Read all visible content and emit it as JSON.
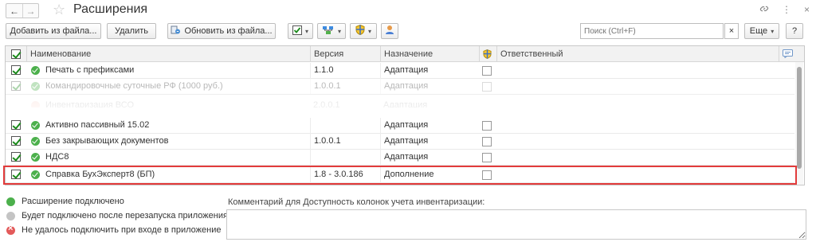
{
  "window": {
    "title": "Расширения",
    "back": "←",
    "forward": "→",
    "star": "☆",
    "link_icon": "🔗",
    "more_icon": "⋮",
    "close_icon": "×"
  },
  "toolbar": {
    "add_from_file": "Добавить из файла...",
    "delete": "Удалить",
    "update_from_file": "Обновить из файла...",
    "search_placeholder": "Поиск (Ctrl+F)",
    "search_clear": "×",
    "more": "Еще",
    "help": "?"
  },
  "table": {
    "columns": {
      "name": "Наименование",
      "version": "Версия",
      "purpose": "Назначение",
      "responsible": "Ответственный"
    },
    "rows": [
      {
        "name": "Печать с префиксами",
        "version": "1.1.0",
        "purpose": "Адаптация"
      },
      {
        "name": "Командировочные суточные РФ (1000 руб.)",
        "version": "1.0.0.1",
        "purpose": "Адаптация"
      },
      {
        "name": "Инвентаризация ВСО",
        "version": "2.0.0.1",
        "purpose": "Адаптация"
      },
      {
        "name": "Активно пассивный 15.02",
        "version": "",
        "purpose": "Адаптация"
      },
      {
        "name": "Без закрывающих документов",
        "version": "1.0.0.1",
        "purpose": "Адаптация"
      },
      {
        "name": "НДС8",
        "version": "",
        "purpose": "Адаптация"
      },
      {
        "name": "Справка БухЭксперт8 (БП)",
        "version": "1.8 - 3.0.186",
        "purpose": "Дополнение"
      }
    ]
  },
  "legend": {
    "connected": "Расширение подключено",
    "after_restart": "Будет подключено после перезапуска приложения",
    "failed": "Не удалось подключить при входе в приложение"
  },
  "comment": {
    "label": "Комментарий для Доступность колонок учета инвентаризации:"
  },
  "colors": {
    "accent_green": "#4cb04c",
    "highlight_red": "#e23b3b"
  }
}
